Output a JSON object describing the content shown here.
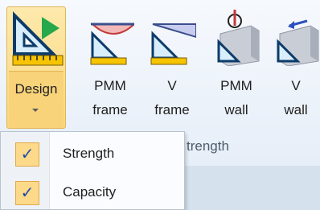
{
  "ribbon": {
    "design_button": {
      "label": "Design",
      "icon": "design-triangle-play-icon"
    },
    "tools": [
      {
        "label_top": "PMM",
        "label_bottom": "frame",
        "icon": "pmm-frame-icon"
      },
      {
        "label_top": "V",
        "label_bottom": "frame",
        "icon": "v-frame-icon"
      },
      {
        "label_top": "PMM",
        "label_bottom": "wall",
        "icon": "pmm-wall-icon"
      },
      {
        "label_top": "V",
        "label_bottom": "wall",
        "icon": "v-wall-icon"
      }
    ],
    "group_label_partial": "trength"
  },
  "dropdown": {
    "items": [
      {
        "label": "Strength",
        "checked": true
      },
      {
        "label": "Capacity",
        "checked": true
      }
    ],
    "check_glyph": "✓"
  },
  "colors": {
    "accent_yellow": "#fbd77a",
    "check_blue": "#1d4fa8",
    "green_play": "#27a84a"
  }
}
